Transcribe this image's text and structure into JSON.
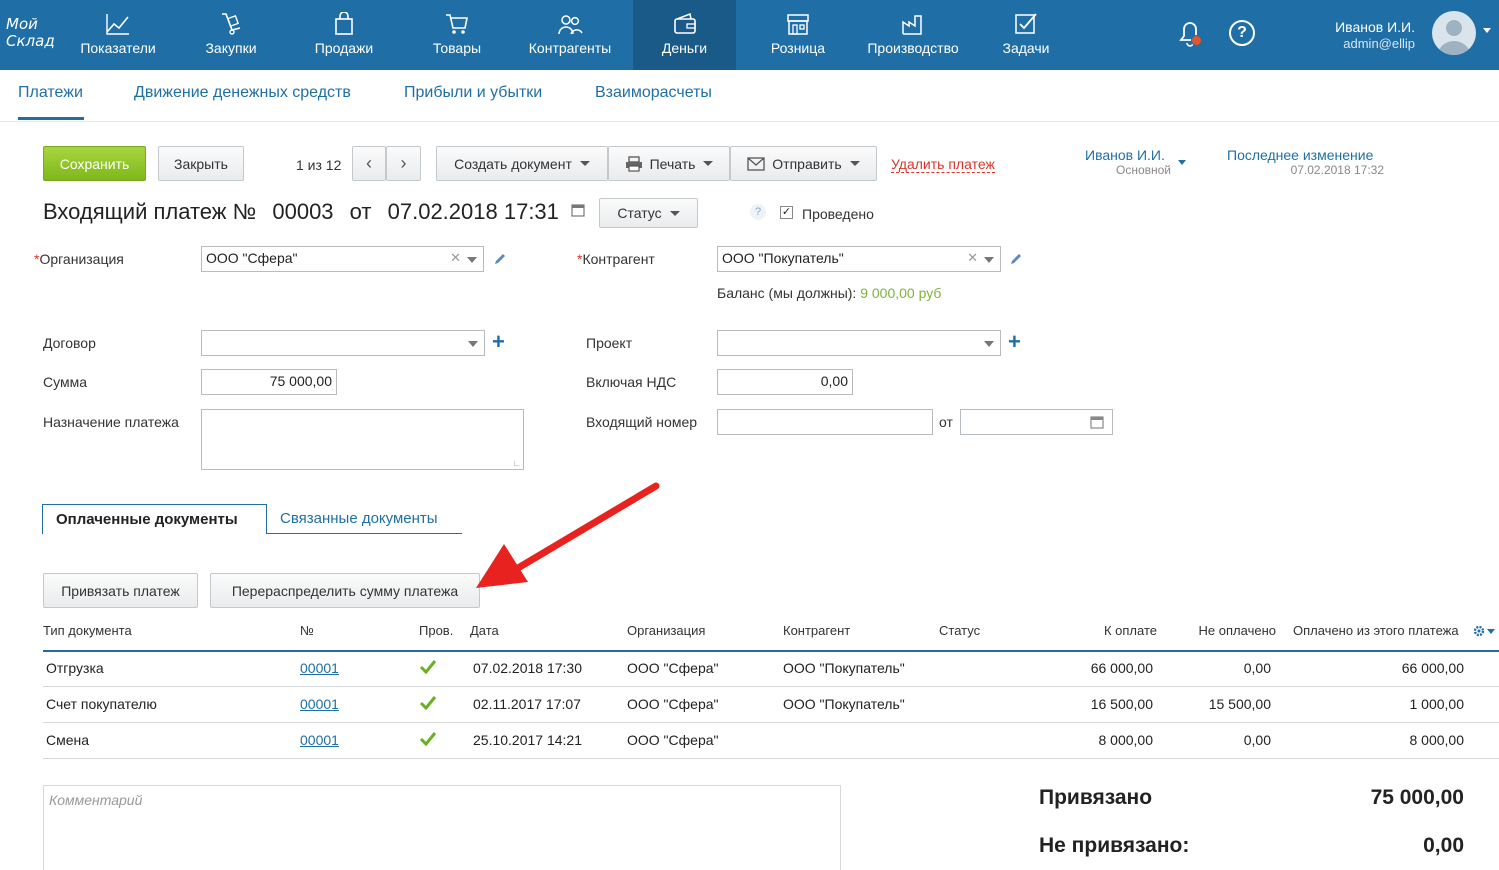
{
  "app": {
    "logo_line1": "Мой",
    "logo_line2": "Склад"
  },
  "nav": {
    "items": [
      {
        "label": "Показатели",
        "icon": "chart-icon"
      },
      {
        "label": "Закупки",
        "icon": "cart-dolly-icon"
      },
      {
        "label": "Продажи",
        "icon": "bag-icon"
      },
      {
        "label": "Товары",
        "icon": "shopping-cart-icon"
      },
      {
        "label": "Контрагенты",
        "icon": "users-icon"
      },
      {
        "label": "Деньги",
        "icon": "wallet-icon"
      },
      {
        "label": "Розница",
        "icon": "shop-icon"
      },
      {
        "label": "Производство",
        "icon": "factory-icon"
      },
      {
        "label": "Задачи",
        "icon": "task-check-icon"
      }
    ],
    "active": "Деньги"
  },
  "user": {
    "name": "Иванов И.И.",
    "email": "admin@ellip"
  },
  "subtabs": [
    "Платежи",
    "Движение денежных средств",
    "Прибыли и убытки",
    "Взаиморасчеты"
  ],
  "toolbar": {
    "save": "Сохранить",
    "close": "Закрыть",
    "pager": "1 из 12",
    "create_doc": "Создать документ",
    "print": "Печать",
    "send": "Отправить",
    "delete": "Удалить платеж",
    "owner": "Иванов И.И.",
    "owner_sub": "Основной",
    "last_change_label": "Последнее изменение",
    "last_change_value": "07.02.2018 17:32"
  },
  "doc": {
    "title_prefix": "Входящий платеж №",
    "number": "00003",
    "from": "от",
    "date": "07.02.2018 17:31",
    "status_label": "Статус",
    "help": "?",
    "posted_label": "Проведено"
  },
  "form": {
    "org_label": "Организация",
    "org_value": "ООО \"Сфера\"",
    "contractor_label": "Контрагент",
    "contractor_value": "ООО \"Покупатель\"",
    "balance_label": "Баланс (мы должны):",
    "balance_value": "9 000,00 руб",
    "contract_label": "Договор",
    "project_label": "Проект",
    "sum_label": "Сумма",
    "sum_value": "75 000,00",
    "vat_label": "Включая НДС",
    "vat_value": "0,00",
    "purpose_label": "Назначение платежа",
    "incoming_label": "Входящий номер",
    "incoming_from": "от"
  },
  "doctabs": [
    "Оплаченные документы",
    "Связанные документы"
  ],
  "actions": {
    "bind": "Привязать платеж",
    "redistribute": "Перераспределить сумму платежа"
  },
  "table": {
    "headers": [
      "Тип документа",
      "№",
      "Пров.",
      "Дата",
      "Организация",
      "Контрагент",
      "Статус",
      "К оплате",
      "Не оплачено",
      "Оплачено из этого платежа"
    ],
    "rows": [
      {
        "type": "Отгрузка",
        "num": "00001",
        "date": "07.02.2018 17:30",
        "org": "ООО \"Сфера\"",
        "contractor": "ООО \"Покупатель\"",
        "status": "",
        "to_pay": "66 000,00",
        "unpaid": "0,00",
        "paid": "66 000,00"
      },
      {
        "type": "Счет покупателю",
        "num": "00001",
        "date": "02.11.2017 17:07",
        "org": "ООО \"Сфера\"",
        "contractor": "ООО \"Покупатель\"",
        "status": "",
        "to_pay": "16 500,00",
        "unpaid": "15 500,00",
        "paid": "1 000,00"
      },
      {
        "type": "Смена",
        "num": "00001",
        "date": "25.10.2017 14:21",
        "org": "ООО \"Сфера\"",
        "contractor": "",
        "status": "",
        "to_pay": "8 000,00",
        "unpaid": "0,00",
        "paid": "8 000,00"
      }
    ]
  },
  "comment_placeholder": "Комментарий",
  "totals": {
    "bound_label": "Привязано",
    "bound_value": "75 000,00",
    "unbound_label": "Не привязано:",
    "unbound_value": "0,00"
  },
  "colors": {
    "topbar": "#1f6fa6",
    "active_nav": "#195a88",
    "save_button": "#8dc42a",
    "balance": "#7cb33a",
    "arrow": "#e8231f",
    "check": "#6ab023"
  }
}
